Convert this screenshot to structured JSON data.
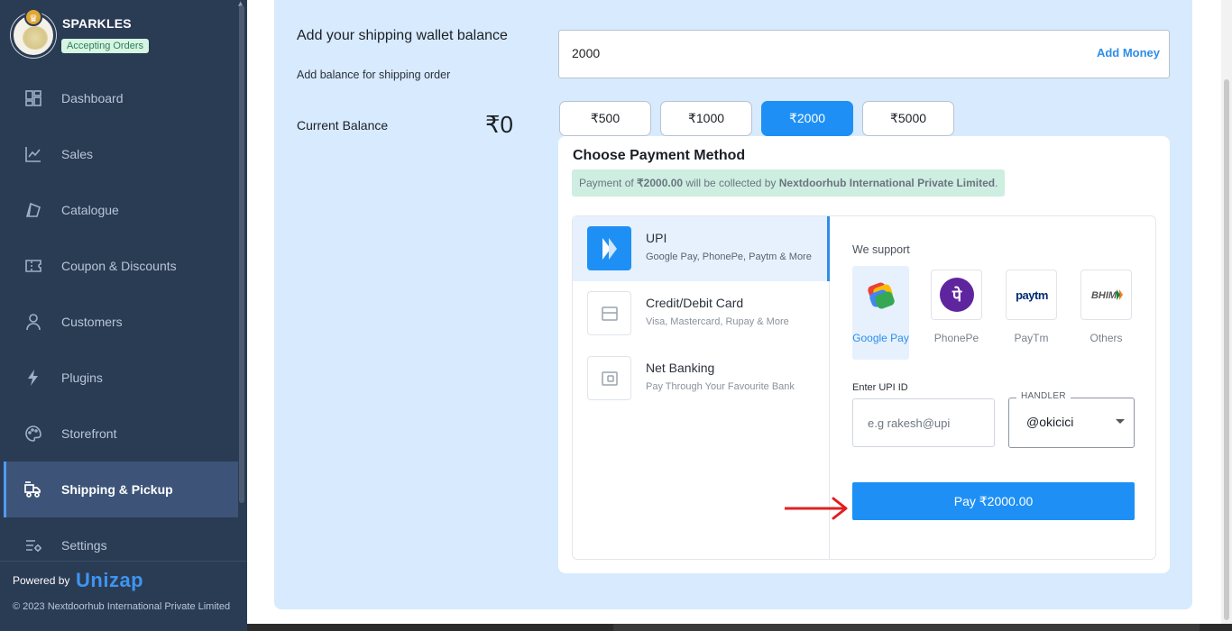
{
  "brand": {
    "name": "SPARKLES",
    "status": "Accepting Orders"
  },
  "nav": [
    {
      "label": "Dashboard",
      "icon": "dashboard-icon"
    },
    {
      "label": "Sales",
      "icon": "chart-line-icon"
    },
    {
      "label": "Catalogue",
      "icon": "catalogue-icon"
    },
    {
      "label": "Coupon & Discounts",
      "icon": "coupon-icon"
    },
    {
      "label": "Customers",
      "icon": "user-icon"
    },
    {
      "label": "Plugins",
      "icon": "bolt-icon"
    },
    {
      "label": "Storefront",
      "icon": "palette-icon"
    },
    {
      "label": "Shipping & Pickup",
      "icon": "shipping-icon",
      "active": true
    },
    {
      "label": "Settings",
      "icon": "settings-icon"
    }
  ],
  "footer": {
    "powered_by": "Powered by",
    "logo": "Unizap",
    "copyright": "© 2023 Nextdoorhub International Private Limited"
  },
  "wallet": {
    "title": "Add your shipping wallet balance",
    "subtitle": "Add balance for shipping order",
    "amount_value": "2000",
    "add_money_label": "Add Money",
    "current_balance_label": "Current Balance",
    "current_balance_value": "₹0",
    "presets": [
      "₹500",
      "₹1000",
      "₹2000",
      "₹5000"
    ],
    "active_preset": "₹2000"
  },
  "payment": {
    "title": "Choose Payment Method",
    "notice_pre": "Payment of ",
    "notice_amount": "₹2000.00",
    "notice_mid": " will be collected by ",
    "notice_company": "Nextdoorhub International Private Limited",
    "notice_end": ".",
    "methods": [
      {
        "name": "UPI",
        "desc": "Google Pay, PhonePe, Paytm & More",
        "icon": "upi-icon"
      },
      {
        "name": "Credit/Debit Card",
        "desc": "Visa, Mastercard, Rupay & More",
        "icon": "card-icon"
      },
      {
        "name": "Net Banking",
        "desc": "Pay Through Your Favourite Bank",
        "icon": "bank-icon"
      }
    ],
    "we_support": "We support",
    "apps": [
      {
        "name": "Google Pay",
        "icon": "google-pay-icon"
      },
      {
        "name": "PhonePe",
        "icon": "phonepe-icon"
      },
      {
        "name": "PayTm",
        "icon": "paytm-icon"
      },
      {
        "name": "Others",
        "icon": "bhim-icon"
      }
    ],
    "paytm_logo_text": "paytm",
    "bhim_logo_text": "BHIM",
    "phonepe_glyph": "पे",
    "upi_label": "Enter UPI ID",
    "upi_placeholder": "e.g rakesh@upi",
    "handler_label": "HANDLER",
    "handler_value": "@okicici",
    "pay_button": "Pay ₹2000.00"
  },
  "colors": {
    "accent": "#1e90f5",
    "sidebar": "#2a3b54",
    "panel": "#d8eafd",
    "arrow": "#e02020"
  }
}
